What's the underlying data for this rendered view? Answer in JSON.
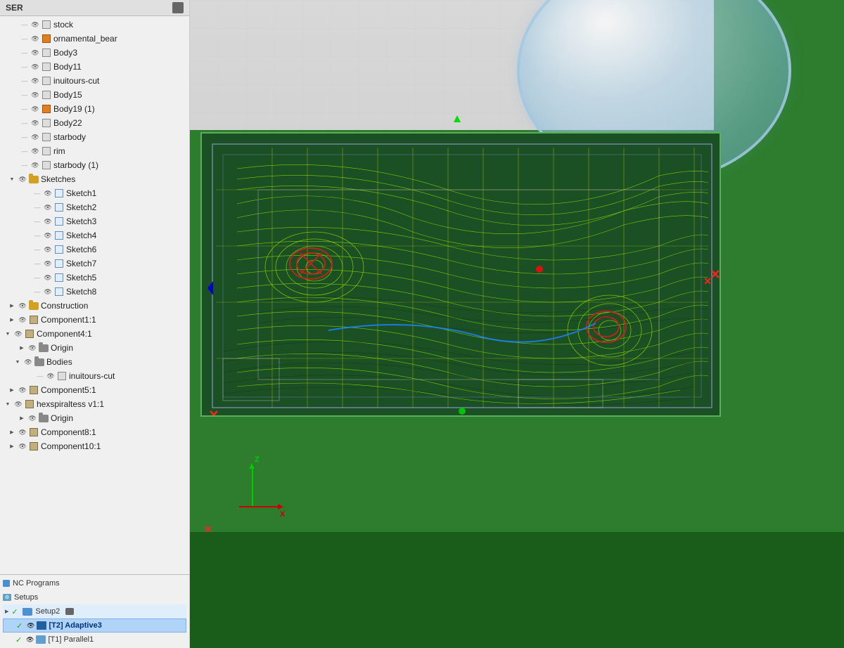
{
  "sidebar": {
    "header": {
      "title": "SER",
      "icon": "panel-icon"
    },
    "tree_items": [
      {
        "id": "stock",
        "indent": 2,
        "expand": false,
        "eye": true,
        "icon": "box",
        "label": "stock",
        "depth": 1
      },
      {
        "id": "ornamental_bear",
        "indent": 2,
        "expand": false,
        "eye": true,
        "icon": "box-orange",
        "label": "ornamental_bear",
        "depth": 1
      },
      {
        "id": "Body3",
        "indent": 2,
        "expand": false,
        "eye": true,
        "icon": "box",
        "label": "Body3",
        "depth": 1
      },
      {
        "id": "Body11",
        "indent": 2,
        "expand": false,
        "eye": true,
        "icon": "box",
        "label": "Body11",
        "depth": 1
      },
      {
        "id": "inuitours-cut",
        "indent": 2,
        "expand": false,
        "eye": true,
        "icon": "box",
        "label": "inuitours-cut",
        "depth": 1
      },
      {
        "id": "Body15",
        "indent": 2,
        "expand": false,
        "eye": true,
        "icon": "box",
        "label": "Body15",
        "depth": 1
      },
      {
        "id": "Body19",
        "indent": 2,
        "expand": false,
        "eye": true,
        "icon": "box-orange",
        "label": "Body19 (1)",
        "depth": 1
      },
      {
        "id": "Body22",
        "indent": 2,
        "expand": false,
        "eye": true,
        "icon": "box",
        "label": "Body22",
        "depth": 1
      },
      {
        "id": "starbody",
        "indent": 2,
        "expand": false,
        "eye": true,
        "icon": "box",
        "label": "starbody",
        "depth": 1
      },
      {
        "id": "rim",
        "indent": 2,
        "expand": false,
        "eye": true,
        "icon": "box",
        "label": "rim",
        "depth": 1
      },
      {
        "id": "starbody1",
        "indent": 2,
        "expand": false,
        "eye": true,
        "icon": "box",
        "label": "starbody (1)",
        "depth": 1
      },
      {
        "id": "Sketches",
        "indent": 1,
        "expand": true,
        "eye": true,
        "icon": "folder",
        "label": "Sketches",
        "depth": 0
      },
      {
        "id": "Sketch1",
        "indent": 3,
        "expand": false,
        "eye": true,
        "icon": "sketch",
        "label": "Sketch1",
        "depth": 2
      },
      {
        "id": "Sketch2",
        "indent": 3,
        "expand": false,
        "eye": true,
        "icon": "sketch",
        "label": "Sketch2",
        "depth": 2
      },
      {
        "id": "Sketch3",
        "indent": 3,
        "expand": false,
        "eye": true,
        "icon": "sketch",
        "label": "Sketch3",
        "depth": 2
      },
      {
        "id": "Sketch4",
        "indent": 3,
        "expand": false,
        "eye": true,
        "icon": "sketch",
        "label": "Sketch4",
        "depth": 2
      },
      {
        "id": "Sketch6",
        "indent": 3,
        "expand": false,
        "eye": true,
        "icon": "sketch",
        "label": "Sketch6",
        "depth": 2
      },
      {
        "id": "Sketch7",
        "indent": 3,
        "expand": false,
        "eye": true,
        "icon": "sketch",
        "label": "Sketch7",
        "depth": 2
      },
      {
        "id": "Sketch5",
        "indent": 3,
        "expand": false,
        "eye": true,
        "icon": "sketch",
        "label": "Sketch5",
        "depth": 2
      },
      {
        "id": "Sketch8",
        "indent": 3,
        "expand": false,
        "eye": true,
        "icon": "sketch",
        "label": "Sketch8",
        "depth": 2
      },
      {
        "id": "Construction",
        "indent": 1,
        "expand": false,
        "eye": true,
        "icon": "folder",
        "label": "Construction",
        "depth": 0
      },
      {
        "id": "Component1_1",
        "indent": 1,
        "expand": false,
        "eye": true,
        "icon": "component",
        "label": "Component1:1",
        "depth": 0
      },
      {
        "id": "Component4_1",
        "indent": 0,
        "expand": true,
        "eye": true,
        "icon": "component",
        "label": "Component4:1",
        "depth": 0
      },
      {
        "id": "Origin",
        "indent": 2,
        "expand": false,
        "eye": true,
        "icon": "folder-dark",
        "label": "Origin",
        "depth": 1
      },
      {
        "id": "Bodies",
        "indent": 1,
        "expand": true,
        "eye": true,
        "icon": "folder-dark",
        "label": "Bodies",
        "depth": 1
      },
      {
        "id": "inuitours-cut2",
        "indent": 3,
        "expand": false,
        "eye": true,
        "icon": "box",
        "label": "inuitours-cut",
        "depth": 2
      },
      {
        "id": "Component5_1",
        "indent": 1,
        "expand": false,
        "eye": true,
        "icon": "component",
        "label": "Component5:1",
        "depth": 0
      },
      {
        "id": "hexspiraltess",
        "indent": 0,
        "expand": true,
        "eye": true,
        "icon": "component",
        "label": "hexspiraltess v1:1",
        "depth": 0
      },
      {
        "id": "Origin2",
        "indent": 2,
        "expand": false,
        "eye": true,
        "icon": "folder-dark",
        "label": "Origin",
        "depth": 1
      },
      {
        "id": "Component8_1",
        "indent": 1,
        "expand": false,
        "eye": true,
        "icon": "component",
        "label": "Component8:1",
        "depth": 0
      },
      {
        "id": "Component10_1",
        "indent": 1,
        "expand": false,
        "eye": true,
        "icon": "component",
        "label": "Component10:1",
        "depth": 0
      }
    ]
  },
  "bottom_panel": {
    "nc_programs_label": "NC Programs",
    "setups_label": "Setups",
    "setup2_label": "Setup2",
    "adaptive3_label": "[T2] Adaptive3",
    "parallel1_label": "[T1] Parallel1"
  },
  "viewport": {
    "background_color": "#c8c8c8"
  }
}
